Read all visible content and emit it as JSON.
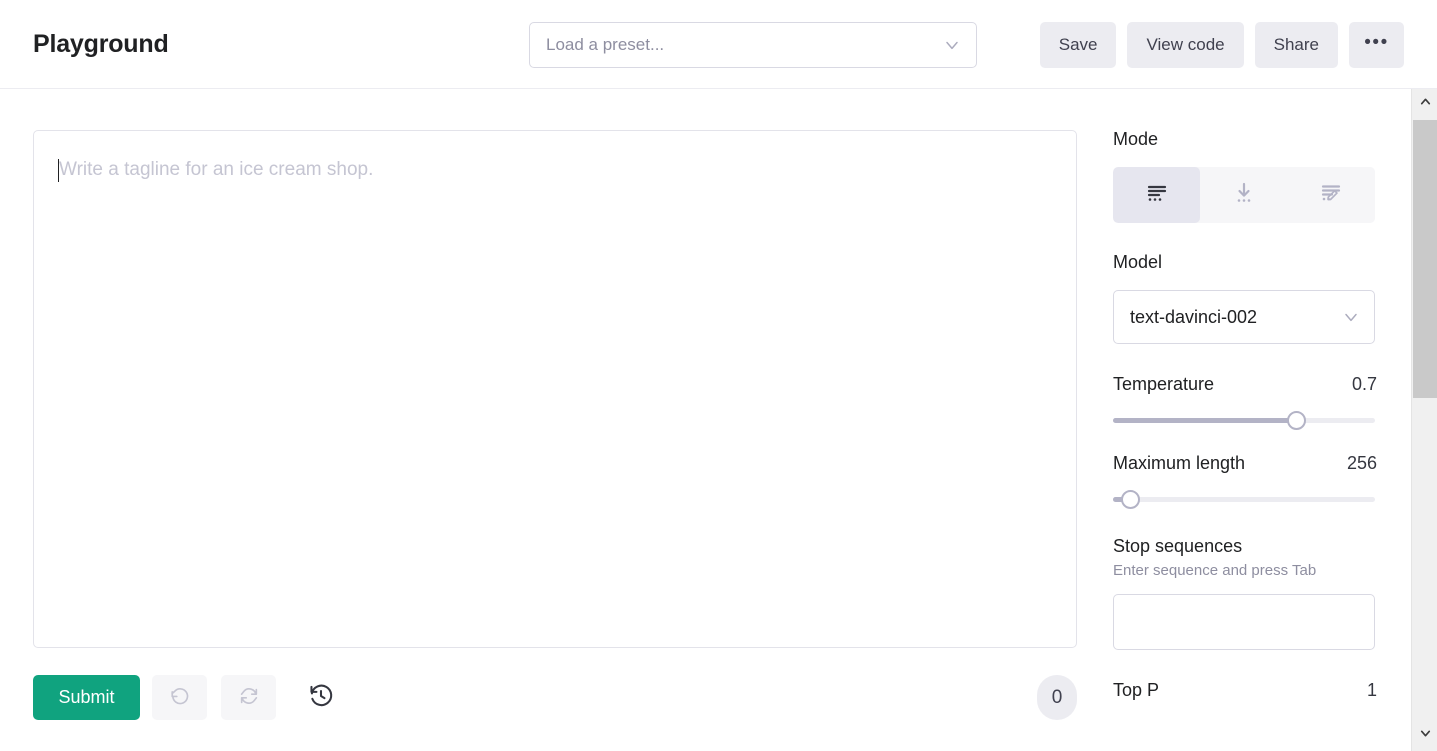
{
  "header": {
    "title": "Playground",
    "preset": {
      "placeholder": "Load a preset...",
      "value": "",
      "chevron_icon": "chevron-down-icon"
    },
    "buttons": [
      {
        "label": "Save",
        "name": "save-button"
      },
      {
        "label": "View code",
        "name": "view-code-button"
      },
      {
        "label": "Share",
        "name": "share-button"
      }
    ],
    "more_label": "•••"
  },
  "prompt": {
    "placeholder": "Write a tagline for an ice cream shop.",
    "value": ""
  },
  "toolbar": {
    "submit_label": "Submit",
    "undo_icon": "undo-icon",
    "regenerate_icon": "regenerate-icon",
    "history_icon": "history-icon",
    "token_count": "0"
  },
  "sidebar": {
    "mode": {
      "label": "Mode",
      "options": [
        {
          "name": "complete",
          "icon": "complete-icon",
          "selected": true
        },
        {
          "name": "insert",
          "icon": "insert-icon",
          "selected": false
        },
        {
          "name": "edit",
          "icon": "edit-icon",
          "selected": false
        }
      ]
    },
    "model": {
      "label": "Model",
      "value": "text-davinci-002",
      "chevron_icon": "chevron-down-icon"
    },
    "temperature": {
      "label": "Temperature",
      "value": "0.7",
      "percent": 70
    },
    "maximum_length": {
      "label": "Maximum length",
      "value": "256",
      "percent": 6.5
    },
    "stop_sequences": {
      "label": "Stop sequences",
      "hint": "Enter sequence and press Tab",
      "value": ""
    },
    "top_p": {
      "label": "Top P",
      "value": "1"
    }
  },
  "scrollbar": {
    "up_icon": "chevron-up-icon",
    "down_icon": "chevron-down-icon"
  },
  "colors": {
    "accent_green": "#10a37f",
    "button_gray": "#ececf1",
    "border": "#d9d9e3",
    "muted_text": "#8e8ea0"
  }
}
